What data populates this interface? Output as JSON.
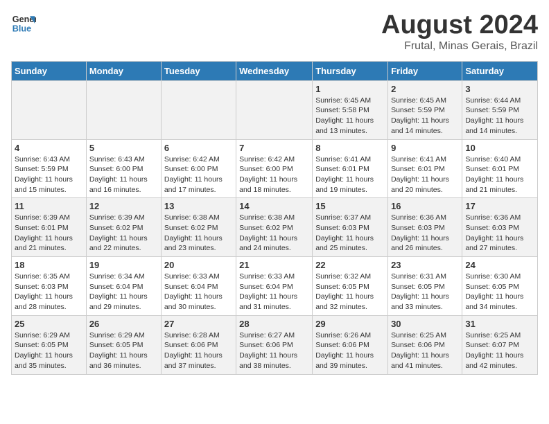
{
  "logo": {
    "line1": "General",
    "line2": "Blue"
  },
  "title": "August 2024",
  "subtitle": "Frutal, Minas Gerais, Brazil",
  "days_of_week": [
    "Sunday",
    "Monday",
    "Tuesday",
    "Wednesday",
    "Thursday",
    "Friday",
    "Saturday"
  ],
  "weeks": [
    [
      {
        "day": "",
        "info": ""
      },
      {
        "day": "",
        "info": ""
      },
      {
        "day": "",
        "info": ""
      },
      {
        "day": "",
        "info": ""
      },
      {
        "day": "1",
        "info": "Sunrise: 6:45 AM\nSunset: 5:58 PM\nDaylight: 11 hours and 13 minutes."
      },
      {
        "day": "2",
        "info": "Sunrise: 6:45 AM\nSunset: 5:59 PM\nDaylight: 11 hours and 14 minutes."
      },
      {
        "day": "3",
        "info": "Sunrise: 6:44 AM\nSunset: 5:59 PM\nDaylight: 11 hours and 14 minutes."
      }
    ],
    [
      {
        "day": "4",
        "info": "Sunrise: 6:43 AM\nSunset: 5:59 PM\nDaylight: 11 hours and 15 minutes."
      },
      {
        "day": "5",
        "info": "Sunrise: 6:43 AM\nSunset: 6:00 PM\nDaylight: 11 hours and 16 minutes."
      },
      {
        "day": "6",
        "info": "Sunrise: 6:42 AM\nSunset: 6:00 PM\nDaylight: 11 hours and 17 minutes."
      },
      {
        "day": "7",
        "info": "Sunrise: 6:42 AM\nSunset: 6:00 PM\nDaylight: 11 hours and 18 minutes."
      },
      {
        "day": "8",
        "info": "Sunrise: 6:41 AM\nSunset: 6:01 PM\nDaylight: 11 hours and 19 minutes."
      },
      {
        "day": "9",
        "info": "Sunrise: 6:41 AM\nSunset: 6:01 PM\nDaylight: 11 hours and 20 minutes."
      },
      {
        "day": "10",
        "info": "Sunrise: 6:40 AM\nSunset: 6:01 PM\nDaylight: 11 hours and 21 minutes."
      }
    ],
    [
      {
        "day": "11",
        "info": "Sunrise: 6:39 AM\nSunset: 6:01 PM\nDaylight: 11 hours and 21 minutes."
      },
      {
        "day": "12",
        "info": "Sunrise: 6:39 AM\nSunset: 6:02 PM\nDaylight: 11 hours and 22 minutes."
      },
      {
        "day": "13",
        "info": "Sunrise: 6:38 AM\nSunset: 6:02 PM\nDaylight: 11 hours and 23 minutes."
      },
      {
        "day": "14",
        "info": "Sunrise: 6:38 AM\nSunset: 6:02 PM\nDaylight: 11 hours and 24 minutes."
      },
      {
        "day": "15",
        "info": "Sunrise: 6:37 AM\nSunset: 6:03 PM\nDaylight: 11 hours and 25 minutes."
      },
      {
        "day": "16",
        "info": "Sunrise: 6:36 AM\nSunset: 6:03 PM\nDaylight: 11 hours and 26 minutes."
      },
      {
        "day": "17",
        "info": "Sunrise: 6:36 AM\nSunset: 6:03 PM\nDaylight: 11 hours and 27 minutes."
      }
    ],
    [
      {
        "day": "18",
        "info": "Sunrise: 6:35 AM\nSunset: 6:03 PM\nDaylight: 11 hours and 28 minutes."
      },
      {
        "day": "19",
        "info": "Sunrise: 6:34 AM\nSunset: 6:04 PM\nDaylight: 11 hours and 29 minutes."
      },
      {
        "day": "20",
        "info": "Sunrise: 6:33 AM\nSunset: 6:04 PM\nDaylight: 11 hours and 30 minutes."
      },
      {
        "day": "21",
        "info": "Sunrise: 6:33 AM\nSunset: 6:04 PM\nDaylight: 11 hours and 31 minutes."
      },
      {
        "day": "22",
        "info": "Sunrise: 6:32 AM\nSunset: 6:05 PM\nDaylight: 11 hours and 32 minutes."
      },
      {
        "day": "23",
        "info": "Sunrise: 6:31 AM\nSunset: 6:05 PM\nDaylight: 11 hours and 33 minutes."
      },
      {
        "day": "24",
        "info": "Sunrise: 6:30 AM\nSunset: 6:05 PM\nDaylight: 11 hours and 34 minutes."
      }
    ],
    [
      {
        "day": "25",
        "info": "Sunrise: 6:29 AM\nSunset: 6:05 PM\nDaylight: 11 hours and 35 minutes."
      },
      {
        "day": "26",
        "info": "Sunrise: 6:29 AM\nSunset: 6:05 PM\nDaylight: 11 hours and 36 minutes."
      },
      {
        "day": "27",
        "info": "Sunrise: 6:28 AM\nSunset: 6:06 PM\nDaylight: 11 hours and 37 minutes."
      },
      {
        "day": "28",
        "info": "Sunrise: 6:27 AM\nSunset: 6:06 PM\nDaylight: 11 hours and 38 minutes."
      },
      {
        "day": "29",
        "info": "Sunrise: 6:26 AM\nSunset: 6:06 PM\nDaylight: 11 hours and 39 minutes."
      },
      {
        "day": "30",
        "info": "Sunrise: 6:25 AM\nSunset: 6:06 PM\nDaylight: 11 hours and 41 minutes."
      },
      {
        "day": "31",
        "info": "Sunrise: 6:25 AM\nSunset: 6:07 PM\nDaylight: 11 hours and 42 minutes."
      }
    ]
  ]
}
